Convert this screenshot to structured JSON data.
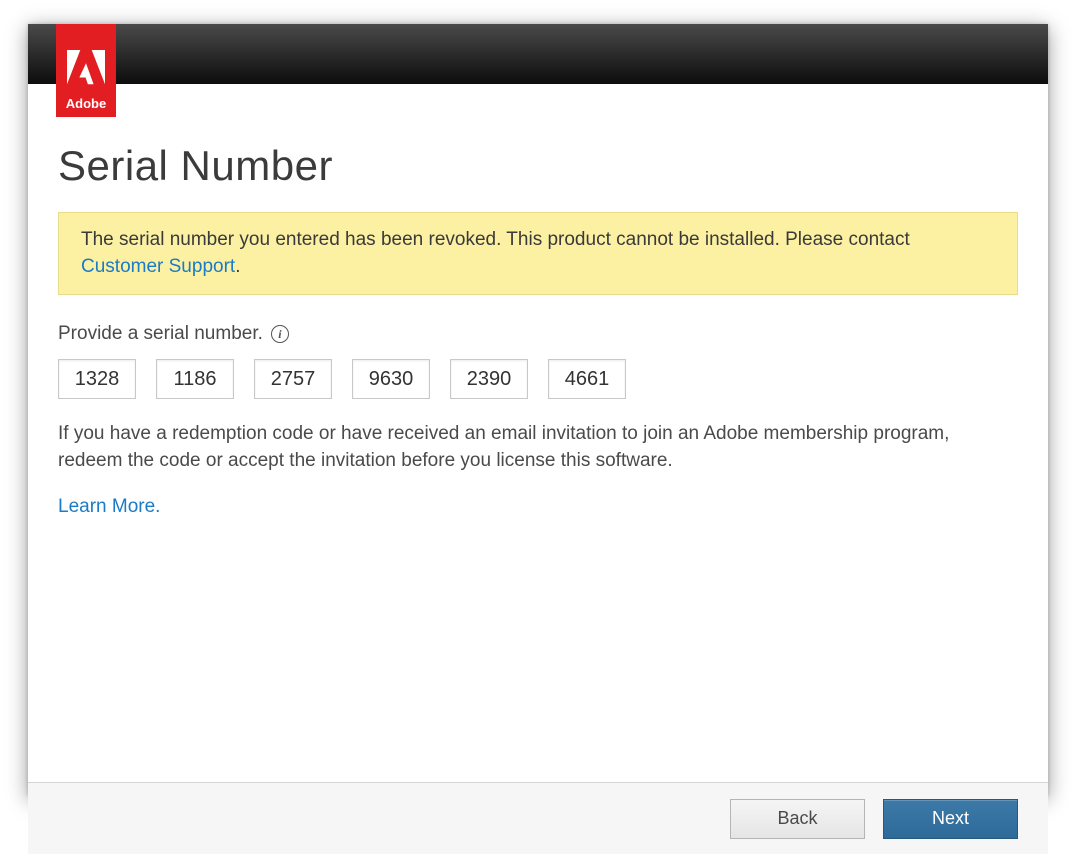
{
  "brand": {
    "name": "Adobe"
  },
  "page": {
    "title": "Serial Number"
  },
  "alert": {
    "message": "The serial number you entered has been revoked. This product cannot be installed. Please contact ",
    "link_text": "Customer Support",
    "suffix": "."
  },
  "prompt": {
    "label": "Provide a serial number."
  },
  "serial": {
    "segments": [
      "1328",
      "1186",
      "2757",
      "9630",
      "2390",
      "4661"
    ]
  },
  "helper": {
    "text": "If you have a redemption code or have received an email invitation to join an Adobe membership program, redeem the code or accept the invitation before you license this software."
  },
  "learn_more": {
    "text": "Learn More."
  },
  "footer": {
    "back": "Back",
    "next": "Next"
  }
}
